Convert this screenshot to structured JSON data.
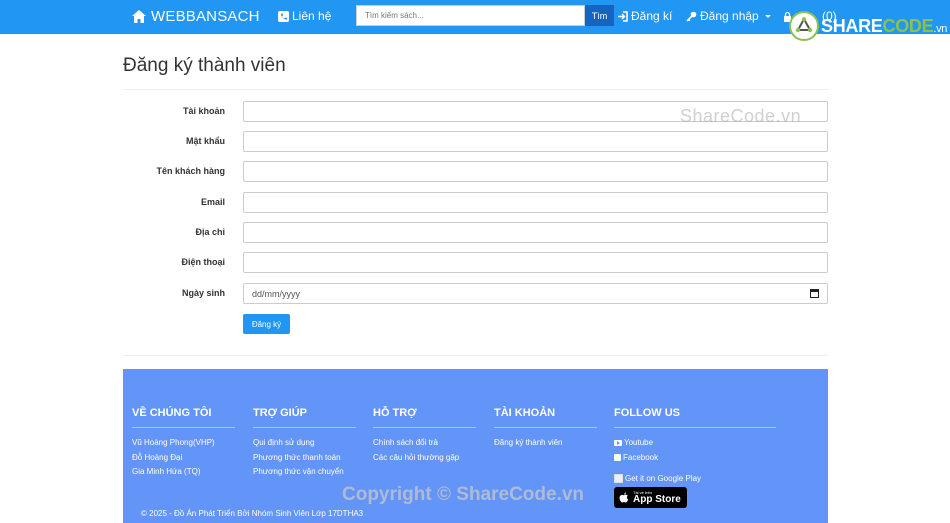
{
  "navbar": {
    "brand": "WEBBANSACH",
    "contact": "Liên hệ",
    "search_placeholder": "Tìm kiếm sách...",
    "search_button": "Tìm",
    "register": "Đăng kí",
    "login": "Đăng nhập",
    "cart": "(0)"
  },
  "logo": {
    "share": "SHARE",
    "code": "CODE",
    "suffix": ".vn"
  },
  "page": {
    "title": "Đăng ký thành viên"
  },
  "form": {
    "fields": [
      {
        "label": "Tài khoản",
        "value": ""
      },
      {
        "label": "Mật khẩu",
        "value": ""
      },
      {
        "label": "Tên khách hàng",
        "value": ""
      },
      {
        "label": "Email",
        "value": ""
      },
      {
        "label": "Địa chỉ",
        "value": ""
      },
      {
        "label": "Điện thoại",
        "value": ""
      },
      {
        "label": "Ngày sinh",
        "value": "dd/mm/yyyy"
      }
    ],
    "submit": "Đăng ký"
  },
  "footer": {
    "columns": [
      {
        "heading": "VỀ CHÚNG TÔI",
        "items": [
          "Vũ Hoàng Phong(VHP)",
          "Đỗ Hoàng Đại",
          "Gia Minh Hứa (TQ)"
        ]
      },
      {
        "heading": "TRỢ GIÚP",
        "items": [
          "Qui định sử dụng",
          "Phương thức thanh toán",
          "Phương thức vận chuyển"
        ]
      },
      {
        "heading": "HỖ TRỢ",
        "items": [
          "Chính sách đổi trả",
          "Các câu hỏi thường gặp"
        ]
      },
      {
        "heading": "TÀI KHOẢN",
        "items": [
          "Đăng ký thành viên"
        ]
      },
      {
        "heading": "FOLLOW US",
        "items": [
          "Youtube",
          "Facebook"
        ]
      }
    ],
    "google_play": "Get it on Google Play",
    "app_store_small": "Tải về trên",
    "app_store": "App Store",
    "copyright": "© 2025 - Đồ Án Phát Triển Bởi Nhóm Sinh Viên Lớp 17DTHA3"
  },
  "watermarks": {
    "top": "ShareCode.vn",
    "bottom": "Copyright © ShareCode.vn"
  },
  "colors": {
    "navbar": "#2196f3",
    "footer": "#6394f8",
    "accent": "#8bc34a"
  }
}
